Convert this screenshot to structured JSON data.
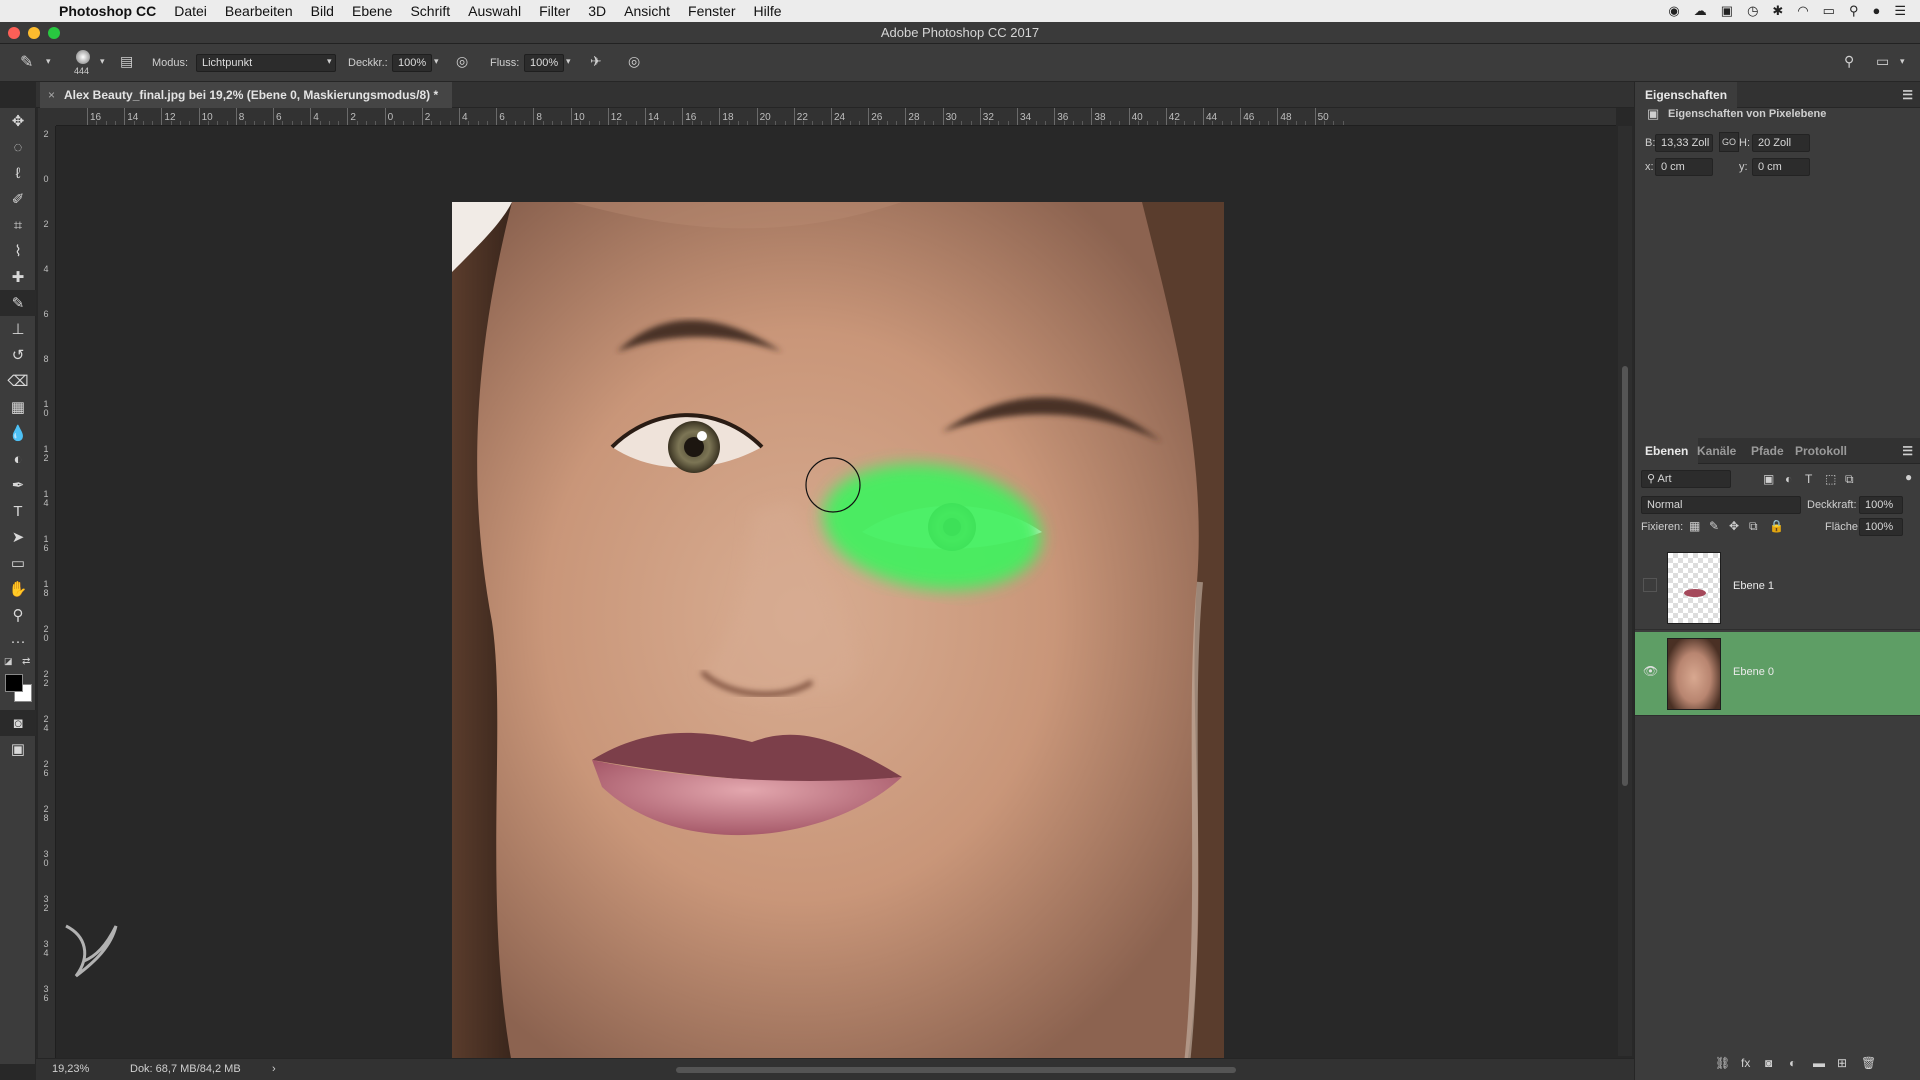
{
  "menubar": {
    "app": "Photoshop CC",
    "items": [
      "Datei",
      "Bearbeiten",
      "Bild",
      "Ebene",
      "Schrift",
      "Auswahl",
      "Filter",
      "3D",
      "Ansicht",
      "Fenster",
      "Hilfe"
    ]
  },
  "window": {
    "title": "Adobe Photoshop CC 2017"
  },
  "options": {
    "brush_size": "444",
    "mode_label": "Modus:",
    "mode_value": "Lichtpunkt",
    "opacity_label": "Deckkr.:",
    "opacity_value": "100%",
    "flow_label": "Fluss:",
    "flow_value": "100%"
  },
  "document": {
    "tab_title": "Alex Beauty_final.jpg bei 19,2% (Ebene 0, Maskierungsmodus/8) *",
    "tab_close": "×"
  },
  "rulers": {
    "horizontal": [
      "16",
      "14",
      "12",
      "10",
      "8",
      "6",
      "4",
      "2",
      "0",
      "2",
      "4",
      "6",
      "8",
      "10",
      "12",
      "14",
      "16",
      "18",
      "20",
      "22",
      "24",
      "26",
      "28",
      "30",
      "32",
      "34",
      "36",
      "38",
      "40",
      "42",
      "44",
      "46",
      "48",
      "50"
    ],
    "vertical": [
      "2",
      "0",
      "2",
      "4",
      "6",
      "8",
      "10",
      "12",
      "14",
      "16",
      "18",
      "20",
      "22",
      "24",
      "26",
      "28",
      "30",
      "32",
      "34",
      "36"
    ]
  },
  "status": {
    "zoom": "19,23%",
    "doc": "Dok: 68,7 MB/84,2 MB",
    "arrow": "›"
  },
  "properties": {
    "title": "Eigenschaften",
    "subtitle": "Eigenschaften von Pixelebene",
    "w_label": "B:",
    "w_value": "13,33 Zoll",
    "h_label": "H:",
    "h_value": "20 Zoll",
    "x_label": "x:",
    "x_value": "0 cm",
    "y_label": "y:",
    "y_value": "0 cm",
    "link_label": "GO"
  },
  "layers_panel": {
    "tabs": [
      "Ebenen",
      "Kanäle",
      "Pfade",
      "Protokoll"
    ],
    "filter_label": "Art",
    "blend_mode": "Normal",
    "opacity_label": "Deckkraft:",
    "opacity_value": "100%",
    "lock_label": "Fixieren:",
    "fill_label": "Fläche:",
    "fill_value": "100%",
    "layers": [
      {
        "name": "Ebene 1",
        "visible": false,
        "selected": false
      },
      {
        "name": "Ebene 0",
        "visible": true,
        "selected": true
      }
    ]
  },
  "colors": {
    "accent_selected_layer": "#5e9e65",
    "mask_overlay": "#3ff25e"
  }
}
